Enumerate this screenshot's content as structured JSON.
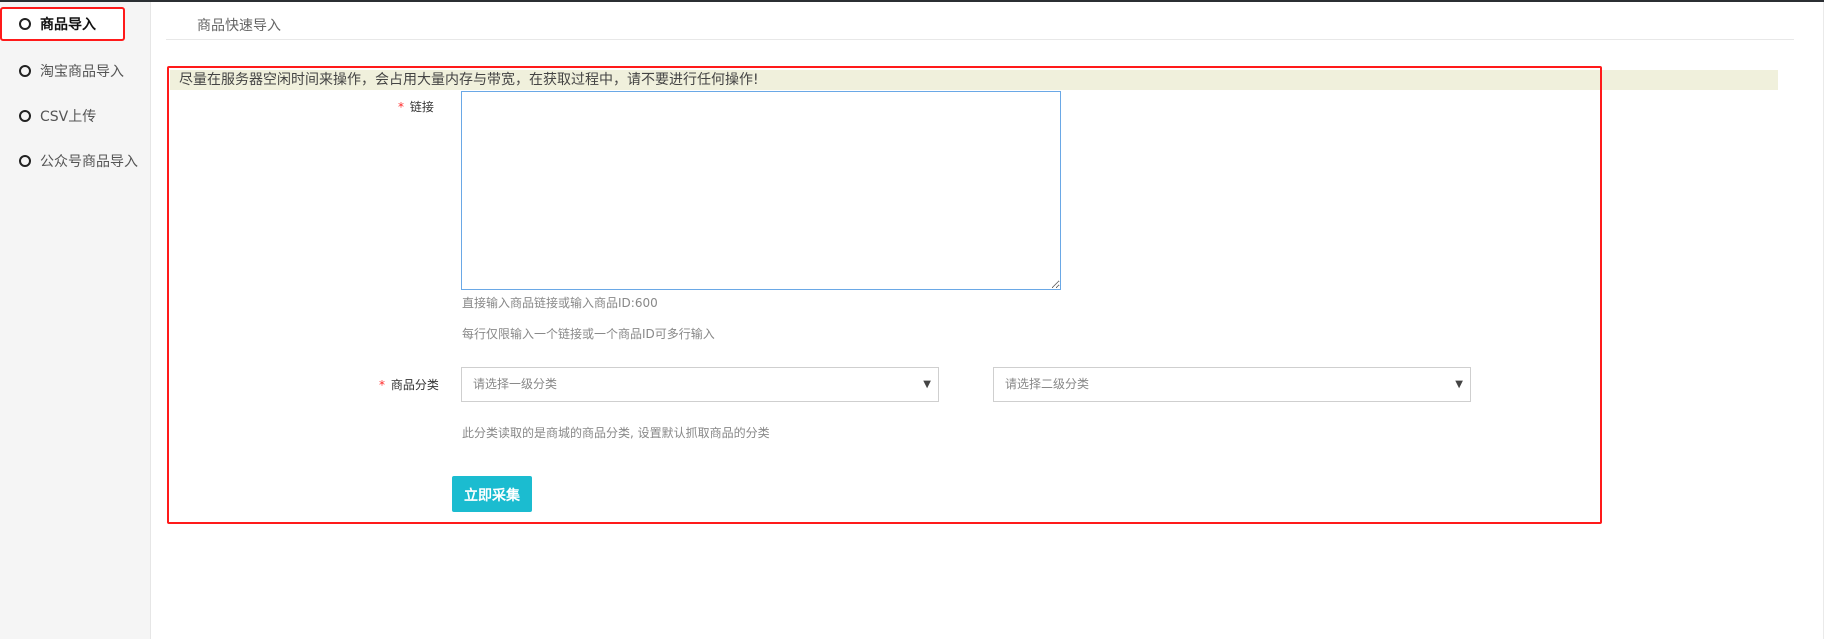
{
  "sidebar": {
    "items": [
      {
        "label": "商品导入",
        "active": true
      },
      {
        "label": "淘宝商品导入",
        "active": false
      },
      {
        "label": "CSV上传",
        "active": false
      },
      {
        "label": "公众号商品导入",
        "active": false
      }
    ]
  },
  "content": {
    "tab_label": "商品快速导入",
    "notice": "尽量在服务器空闲时间来操作，会占用大量内存与带宽，在获取过程中，请不要进行任何操作!"
  },
  "form": {
    "link_field": {
      "required_mark": "*",
      "label": "链接",
      "value": "",
      "help_1": "直接输入商品链接或输入商品ID:600",
      "help_2": "每行仅限输入一个链接或一个商品ID可多行输入"
    },
    "category_field": {
      "required_mark": "*",
      "label": "商品分类",
      "select_1_value": "请选择一级分类",
      "select_2_value": "请选择二级分类",
      "help": "此分类读取的是商城的商品分类, 设置默认抓取商品的分类"
    },
    "submit_label": "立即采集"
  },
  "colors": {
    "accent_button": "#1bbcd0",
    "highlight_border": "#ff1a1a",
    "notice_bg": "#f0f0dc",
    "textarea_focus_border": "#6aa8e6"
  },
  "icons": {
    "sidebar_item": "radio-circle-icon",
    "select": "caret-down-icon"
  }
}
